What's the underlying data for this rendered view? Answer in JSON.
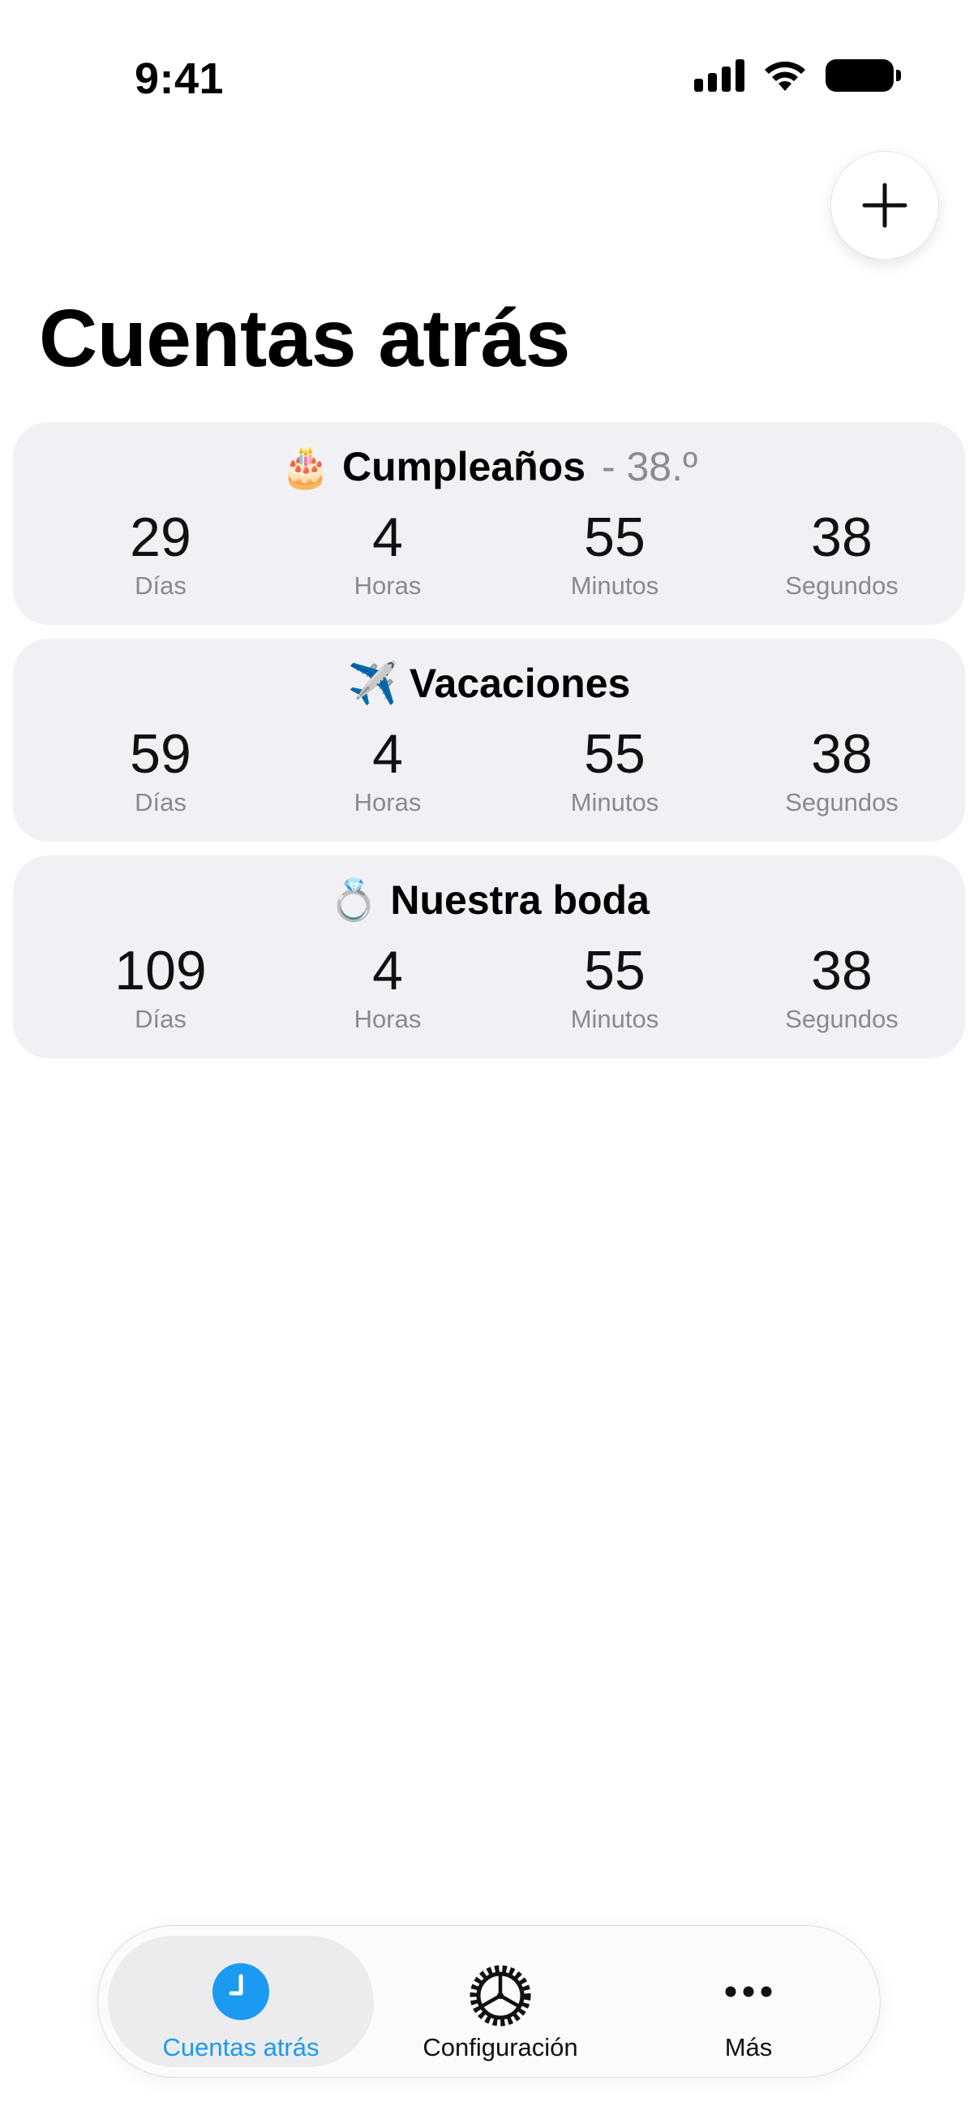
{
  "status_bar": {
    "time": "9:41"
  },
  "header": {
    "title": "Cuentas atrás"
  },
  "countdowns": [
    {
      "emoji": "🎂",
      "name": "Cumpleaños",
      "ordinal": "- 38.º",
      "units": [
        {
          "value": "29",
          "label": "Días"
        },
        {
          "value": "4",
          "label": "Horas"
        },
        {
          "value": "55",
          "label": "Minutos"
        },
        {
          "value": "38",
          "label": "Segundos"
        }
      ]
    },
    {
      "emoji": "✈️",
      "name": "Vacaciones",
      "ordinal": "",
      "units": [
        {
          "value": "59",
          "label": "Días"
        },
        {
          "value": "4",
          "label": "Horas"
        },
        {
          "value": "55",
          "label": "Minutos"
        },
        {
          "value": "38",
          "label": "Segundos"
        }
      ]
    },
    {
      "emoji": "💍",
      "name": "Nuestra boda",
      "ordinal": "",
      "units": [
        {
          "value": "109",
          "label": "Días"
        },
        {
          "value": "4",
          "label": "Horas"
        },
        {
          "value": "55",
          "label": "Minutos"
        },
        {
          "value": "38",
          "label": "Segundos"
        }
      ]
    }
  ],
  "tabbar": {
    "tabs": [
      {
        "label": "Cuentas atrás",
        "icon": "clock-icon",
        "active": true
      },
      {
        "label": "Configuración",
        "icon": "gear-icon",
        "active": false
      },
      {
        "label": "Más",
        "icon": "ellipsis-icon",
        "active": false
      }
    ]
  },
  "colors": {
    "accent": "#1a9af0",
    "card_bg": "#f1f1f5",
    "secondary_text": "#8a8a8e"
  }
}
